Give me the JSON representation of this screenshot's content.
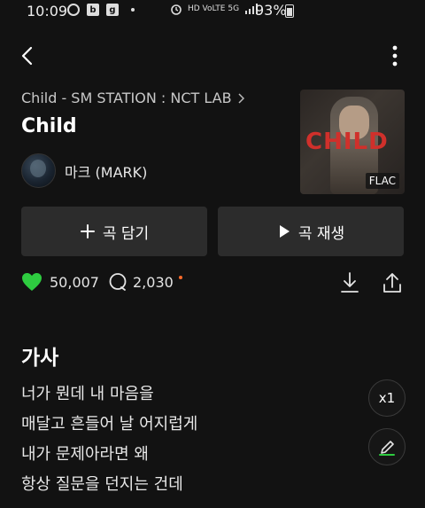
{
  "status_bar": {
    "time": "10:09",
    "left_icons": [
      "ring-icon",
      "b-app-icon",
      "g-app-icon",
      "dot-icon"
    ],
    "right_text": "HD VoLTE 5G",
    "battery": "93%"
  },
  "album": {
    "name": "Child - SM STATION : NCT LAB"
  },
  "song": {
    "title": "Child"
  },
  "artist": {
    "name": "마크 (MARK)"
  },
  "cover": {
    "title": "CHILD",
    "badge": "FLAC"
  },
  "buttons": {
    "add": "곡 담기",
    "play": "곡 재생"
  },
  "stats": {
    "likes": "50,007",
    "comments": "2,030"
  },
  "lyrics": {
    "heading": "가사",
    "lines": [
      "너가 뭔데 내 마음을",
      "매달고 흔들어 날 어지럽게",
      "내가 문제아라면 왜",
      "항상 질문을 던지는 건데"
    ],
    "speed": "x1"
  },
  "colors": {
    "background": "#121212",
    "button_bg": "#2c2c2c",
    "like_green": "#2ecc40",
    "comment_dot": "#ff6a2a"
  }
}
